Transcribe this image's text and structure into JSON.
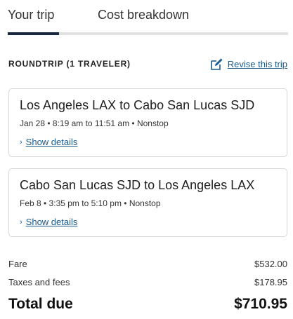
{
  "tabs": [
    {
      "label": "Your trip",
      "active": true
    },
    {
      "label": "Cost breakdown",
      "active": false
    }
  ],
  "trip_header": {
    "label": "ROUNDTRIP (1 TRAVELER)",
    "revise_link": "Revise this trip",
    "revise_icon": "edit-icon"
  },
  "flights": [
    {
      "route": "Los Angeles LAX to Cabo San Lucas SJD",
      "info": "Jan 28 • 8:19 am to 11:51 am • Nonstop",
      "details_link": "Show details"
    },
    {
      "route": "Cabo San Lucas SJD to Los Angeles LAX",
      "info": "Feb 8 • 3:35 pm to 5:10 pm • Nonstop",
      "details_link": "Show details"
    }
  ],
  "costs": {
    "fare_label": "Fare",
    "fare_value": "$532.00",
    "taxes_label": "Taxes and fees",
    "taxes_value": "$178.95",
    "total_label": "Total due",
    "total_value": "$710.95"
  },
  "colors": {
    "accent": "#1a5a8a",
    "tab_indicator": "#1b2940",
    "border": "#d8d8d8"
  }
}
